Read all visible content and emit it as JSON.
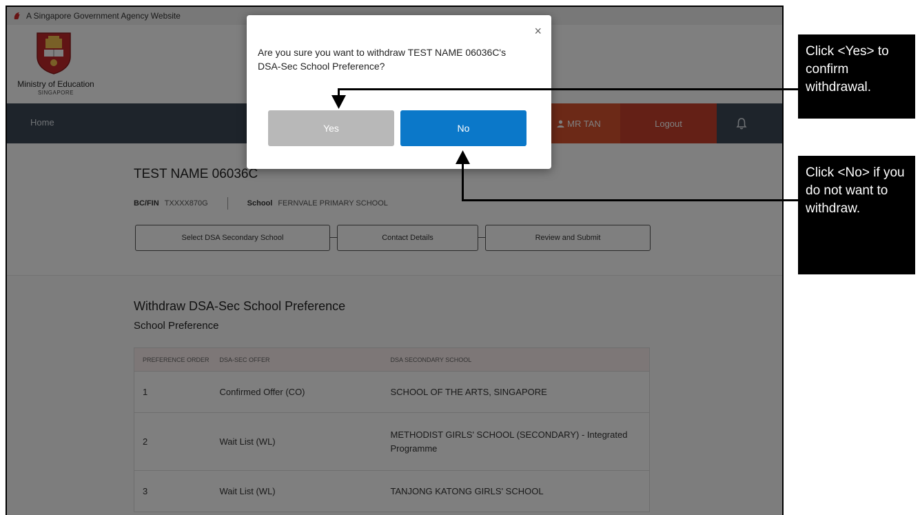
{
  "banner": {
    "text": "A Singapore Government Agency Website"
  },
  "header": {
    "org_name": "Ministry of Education",
    "org_sub": "SINGAPORE"
  },
  "nav": {
    "home": "Home",
    "user": "MR TAN",
    "logout": "Logout"
  },
  "student": {
    "name": "TEST NAME 06036C",
    "id_label": "BC/FIN",
    "id_value": "TXXXX870G",
    "school_label": "School",
    "school_value": "FERNVALE PRIMARY SCHOOL"
  },
  "steps": [
    "Select DSA Secondary School",
    "Contact Details",
    "Review and Submit"
  ],
  "withdraw": {
    "title": "Withdraw DSA-Sec School Preference",
    "subtitle": "School Preference",
    "columns": [
      "PREFERENCE ORDER",
      "DSA-SEC OFFER",
      "DSA SECONDARY SCHOOL"
    ],
    "rows": [
      {
        "order": "1",
        "offer": "Confirmed Offer (CO)",
        "school": "SCHOOL OF THE ARTS, SINGAPORE"
      },
      {
        "order": "2",
        "offer": "Wait List (WL)",
        "school": "METHODIST GIRLS' SCHOOL (SECONDARY) - Integrated Programme"
      },
      {
        "order": "3",
        "offer": "Wait List (WL)",
        "school": "TANJONG KATONG GIRLS' SCHOOL"
      }
    ]
  },
  "dialog": {
    "message": "Are you sure you want to withdraw TEST NAME 06036C's DSA-Sec School Preference?",
    "close": "×",
    "yes": "Yes",
    "no": "No"
  },
  "callouts": {
    "yes": "Click <Yes> to confirm withdrawal.",
    "no": "Click <No> if you do not want to withdraw."
  },
  "colors": {
    "primary": "#0b78c9",
    "nav": "#3d4956",
    "accent": "#d9532f",
    "yes_button": "#b8b8b8"
  }
}
